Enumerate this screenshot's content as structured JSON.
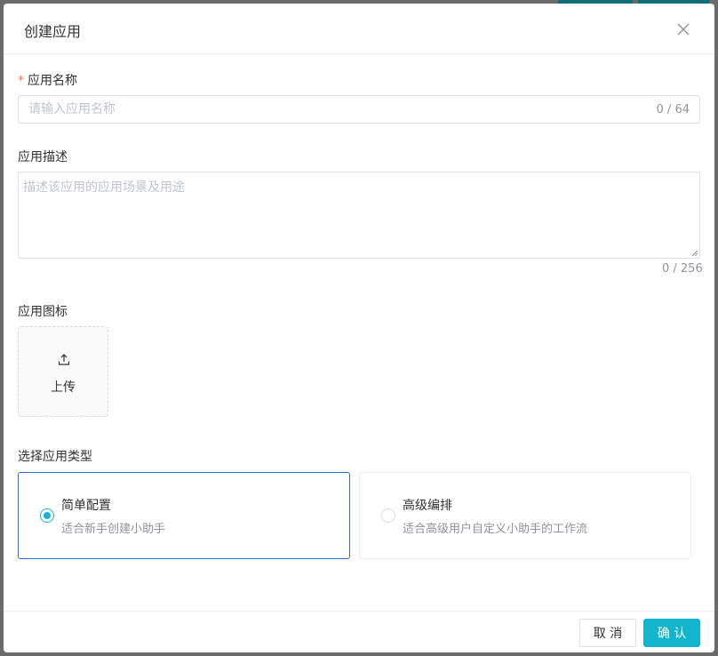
{
  "dialog": {
    "title": "创建应用",
    "close_icon": "close-icon"
  },
  "form": {
    "name_required_mark": "*",
    "name_label": "应用名称",
    "name_value": "",
    "name_placeholder": "请输入应用名称",
    "name_count": "0 / 64",
    "desc_label": "应用描述",
    "desc_value": "",
    "desc_placeholder": "描述该应用的应用场景及用途",
    "desc_count": "0 / 256",
    "icon_label": "应用图标",
    "upload_icon": "upload-icon",
    "upload_text": "上传",
    "type_label": "选择应用类型",
    "types": [
      {
        "title": "简单配置",
        "desc": "适合新手创建小助手",
        "selected": true
      },
      {
        "title": "高级编排",
        "desc": "适合高级用户自定义小助手的工作流",
        "selected": false
      }
    ]
  },
  "footer": {
    "cancel_label": "取 消",
    "confirm_label": "确 认"
  },
  "colors": {
    "accent": "#12b5cb",
    "selected_border": "#2d6fd6",
    "required": "#f56c6c",
    "overlay": "#6b6b6b"
  }
}
